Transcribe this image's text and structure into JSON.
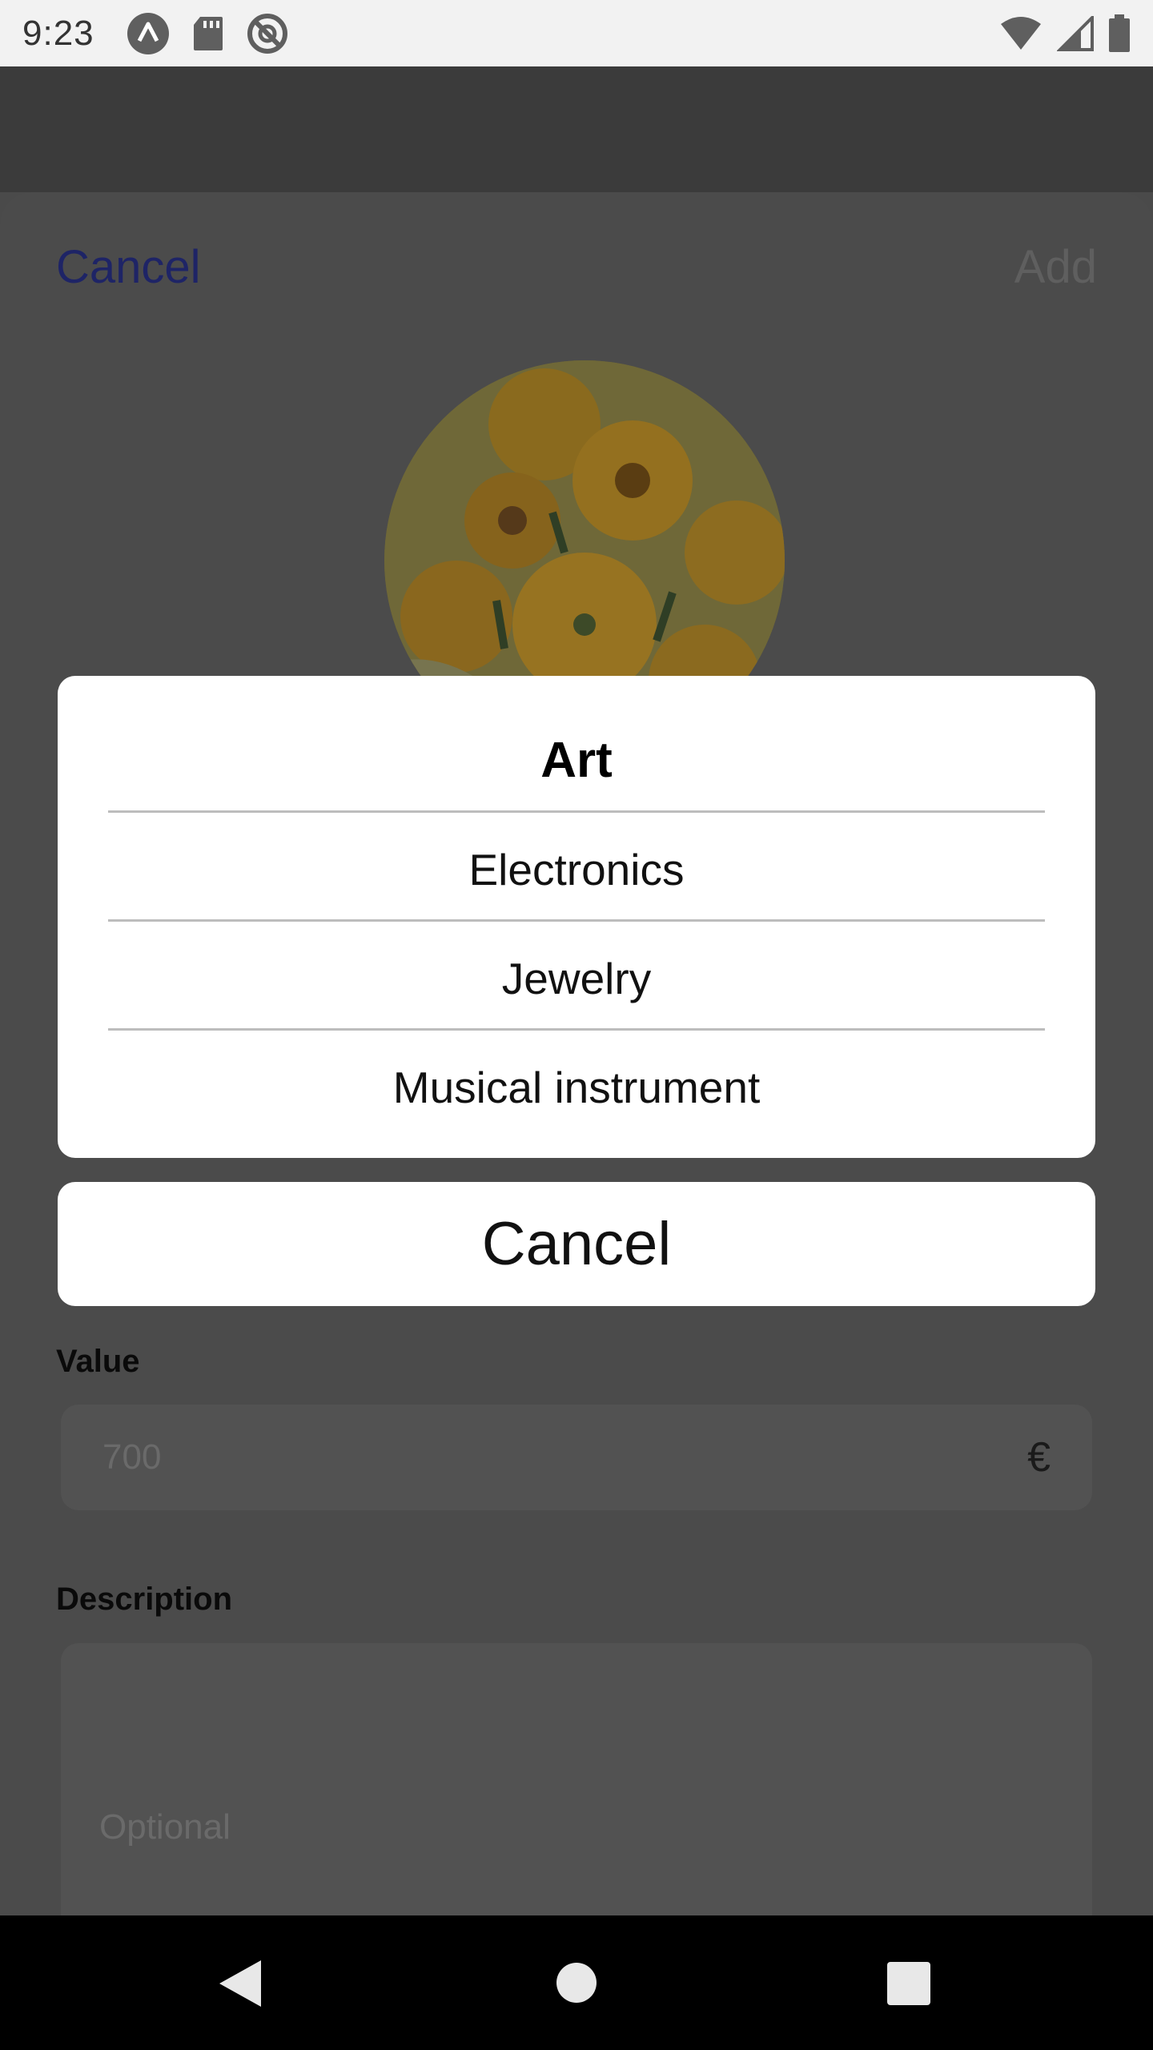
{
  "status_bar": {
    "time": "9:23",
    "left_icons": [
      "a-logo-icon",
      "sd-card-icon",
      "no-sync-icon"
    ],
    "right_icons": [
      "wifi-icon",
      "signal-icon",
      "battery-icon"
    ]
  },
  "sheet": {
    "cancel_label": "Cancel",
    "add_label": "Add",
    "avatar_alt": "sunflowers-image"
  },
  "form": {
    "value_label": "Value",
    "value_placeholder": "700",
    "currency_symbol": "€",
    "description_label": "Description",
    "description_placeholder": "Optional"
  },
  "picker": {
    "options": [
      {
        "label": "Art",
        "selected": true
      },
      {
        "label": "Electronics",
        "selected": false
      },
      {
        "label": "Jewelry",
        "selected": false
      },
      {
        "label": "Musical instrument",
        "selected": false
      }
    ],
    "cancel_label": "Cancel"
  },
  "nav_bar": {
    "icons": [
      "back-icon",
      "home-icon",
      "recents-icon"
    ]
  },
  "colors": {
    "accent_link": "#1e2466",
    "overlay": "#4b4b4b",
    "picker_bg": "#ffffff"
  }
}
